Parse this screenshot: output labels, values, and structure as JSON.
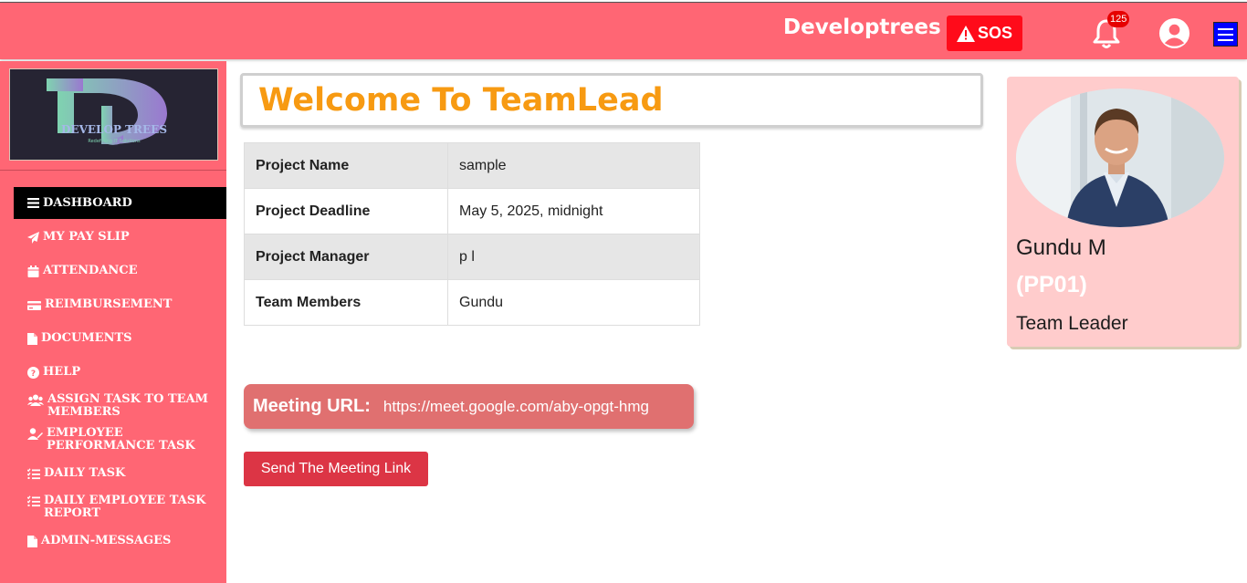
{
  "header": {
    "brand": "Developtrees",
    "sos_label": "SOS",
    "notification_count": "125"
  },
  "sidebar": {
    "logo_text": "DEVELOP TREES",
    "logo_tagline": "Redefining IT Solutions",
    "items": [
      {
        "label": "DASHBOARD",
        "icon": "bars-icon",
        "active": true
      },
      {
        "label": "MY PAY SLIP",
        "icon": "paper-plane-icon"
      },
      {
        "label": "ATTENDANCE",
        "icon": "calendar-icon"
      },
      {
        "label": "REIMBURSEMENT",
        "icon": "credit-card-icon"
      },
      {
        "label": "DOCUMENTS",
        "icon": "file-icon"
      },
      {
        "label": "HELP",
        "icon": "question-circle-icon"
      },
      {
        "label": "ASSIGN TASK TO TEAM MEMBERS",
        "icon": "users-icon"
      },
      {
        "label": "EMPLOYEE PERFORMANCE TASK",
        "icon": "user-edit-icon"
      },
      {
        "label": "DAILY TASK",
        "icon": "tasks-icon"
      },
      {
        "label": "DAILY EMPLOYEE TASK REPORT",
        "icon": "tasks-icon"
      },
      {
        "label": "ADMIN-MESSAGES",
        "icon": "file-icon"
      }
    ]
  },
  "main": {
    "welcome": "Welcome To TeamLead",
    "project": [
      {
        "key": "Project Name",
        "value": "sample"
      },
      {
        "key": "Project Deadline",
        "value": "May 5, 2025, midnight"
      },
      {
        "key": "Project Manager",
        "value": "p l"
      },
      {
        "key": "Team Members",
        "value": "Gundu"
      }
    ],
    "meeting_label": "Meeting URL:",
    "meeting_url": "https://meet.google.com/aby-opgt-hmg",
    "send_button": "Send The Meeting Link"
  },
  "profile": {
    "name": "Gundu M",
    "code": "(PP01)",
    "role": "Team Leader"
  },
  "colors": {
    "brand_bar": "#ff6674",
    "sos": "#ff0b1a",
    "welcome_text": "#f79a12",
    "send_button": "#dc3545",
    "profile_card": "#ffcccc"
  }
}
